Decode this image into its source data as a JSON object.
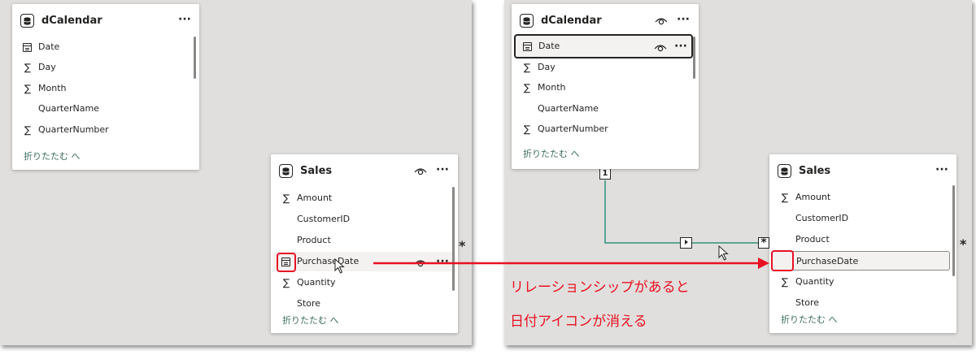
{
  "left_view": {
    "dcalendar": {
      "title": "dCalendar",
      "fields": [
        {
          "label": "Date",
          "icon": "calendar-icon"
        },
        {
          "label": "Day",
          "icon": "sigma-icon"
        },
        {
          "label": "Month",
          "icon": "sigma-icon"
        },
        {
          "label": "QuarterName",
          "icon": ""
        },
        {
          "label": "QuarterNumber",
          "icon": "sigma-icon"
        }
      ],
      "collapse_label": "折りたたむ へ"
    },
    "sales": {
      "title": "Sales",
      "fields": [
        {
          "label": "Amount",
          "icon": "sigma-icon"
        },
        {
          "label": "CustomerID",
          "icon": ""
        },
        {
          "label": "Product",
          "icon": ""
        },
        {
          "label": "PurchaseDate",
          "icon": "calendar-icon"
        },
        {
          "label": "Quantity",
          "icon": "sigma-icon"
        },
        {
          "label": "Store",
          "icon": ""
        }
      ],
      "collapse_label": "折りたたむ へ",
      "edge_marker": "*"
    }
  },
  "right_view": {
    "dcalendar": {
      "title": "dCalendar",
      "fields": [
        {
          "label": "Date",
          "icon": "calendar-icon"
        },
        {
          "label": "Day",
          "icon": "sigma-icon"
        },
        {
          "label": "Month",
          "icon": "sigma-icon"
        },
        {
          "label": "QuarterName",
          "icon": ""
        },
        {
          "label": "QuarterNumber",
          "icon": "sigma-icon"
        }
      ],
      "collapse_label": "折りたたむ へ"
    },
    "sales": {
      "title": "Sales",
      "fields": [
        {
          "label": "Amount",
          "icon": "sigma-icon"
        },
        {
          "label": "CustomerID",
          "icon": ""
        },
        {
          "label": "Product",
          "icon": ""
        },
        {
          "label": "PurchaseDate",
          "icon": ""
        },
        {
          "label": "Quantity",
          "icon": "sigma-icon"
        },
        {
          "label": "Store",
          "icon": ""
        }
      ],
      "collapse_label": "折りたたむ へ",
      "edge_marker": "*"
    },
    "relationship": {
      "one_side": "1",
      "many_side": "*"
    }
  },
  "icons": {
    "sigma": "∑",
    "more": "···"
  },
  "annotation": {
    "line1": "リレーションシップがあると",
    "line2": "日付アイコンが消える"
  },
  "colors": {
    "canvas": "#e1dfdd",
    "relationship_line": "#4a9d89",
    "highlight_red": "#e81123",
    "collapse_text": "#3c6e60"
  }
}
